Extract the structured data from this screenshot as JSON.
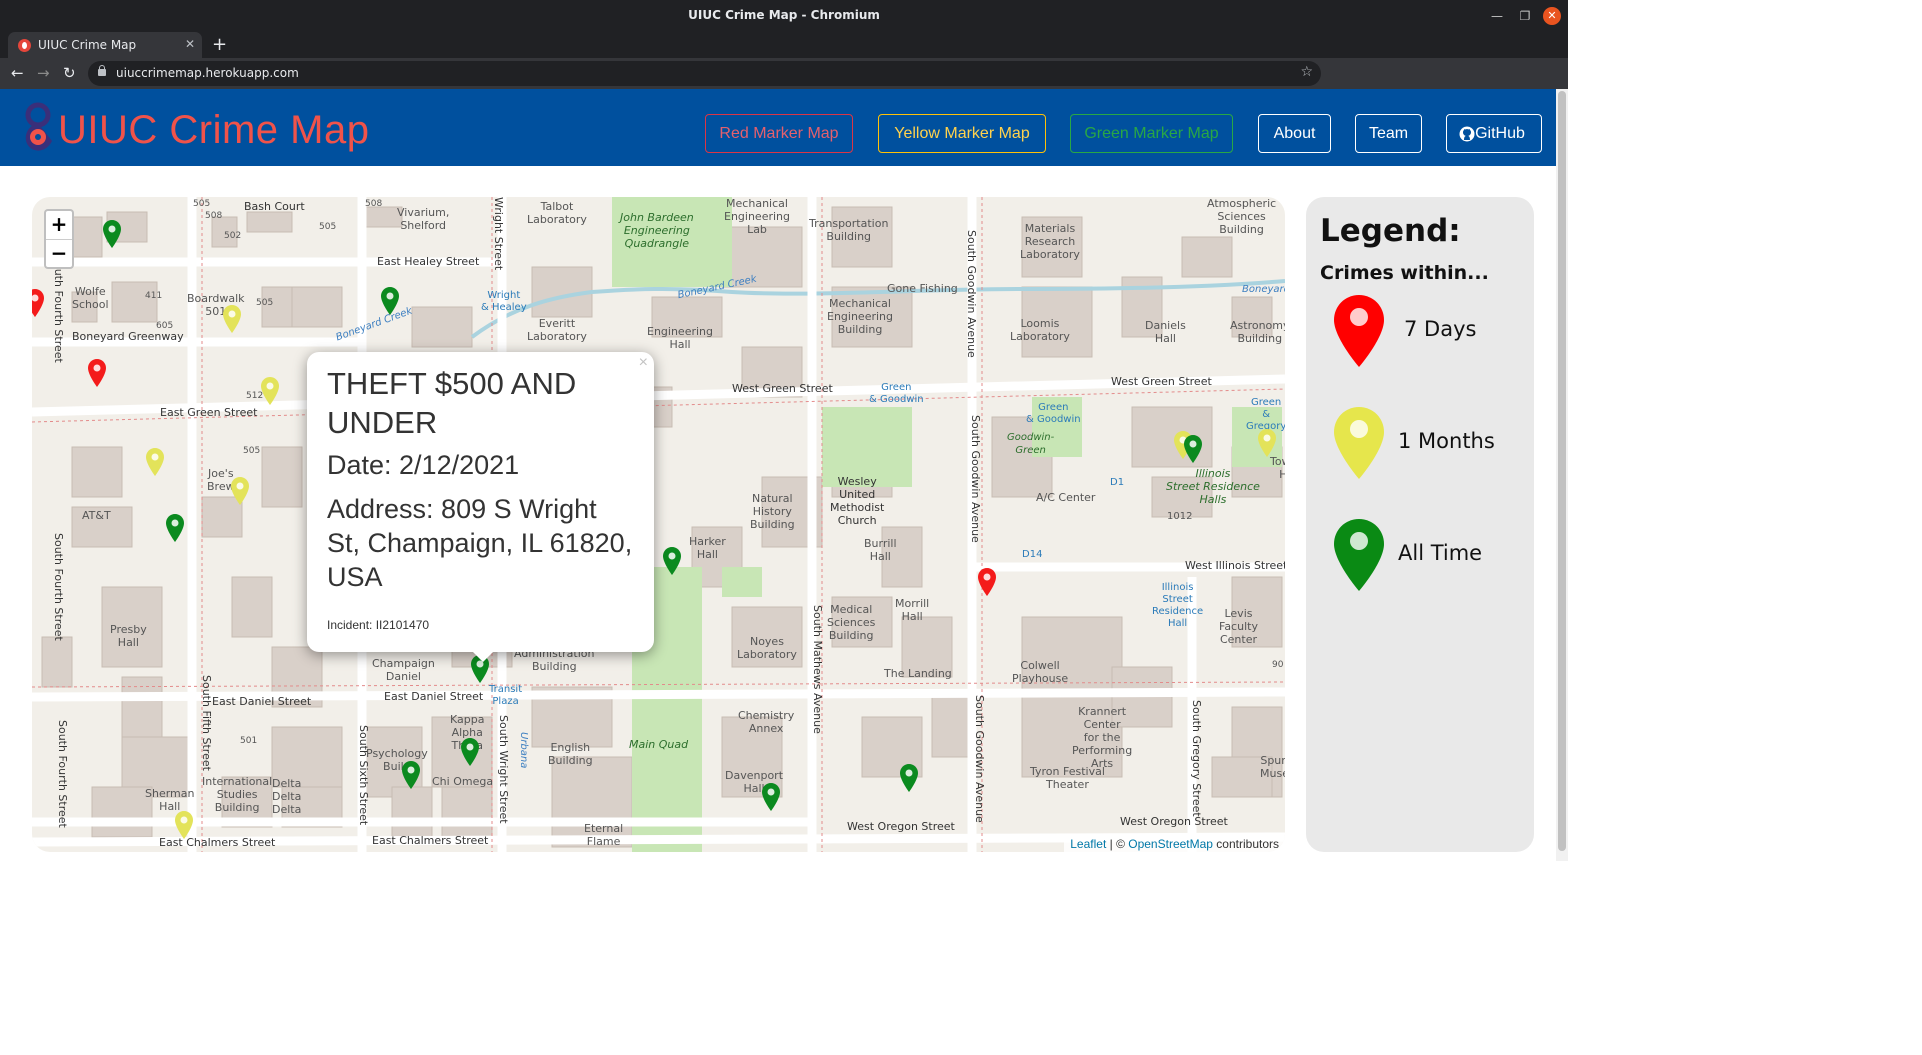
{
  "window": {
    "title": "UIUC Crime Map - Chromium"
  },
  "browser": {
    "tab_title": "UIUC Crime Map",
    "url": "uiuccrimemap.herokuapp.com"
  },
  "navbar": {
    "brand": "UIUC Crime Map",
    "buttons": {
      "red": "Red Marker Map",
      "yellow": "Yellow Marker Map",
      "green": "Green Marker Map",
      "about": "About",
      "team": "Team",
      "github": "GitHub"
    }
  },
  "map": {
    "zoom_in": "+",
    "zoom_out": "−",
    "attribution": {
      "leaflet": "Leaflet",
      "sep": " | © ",
      "osm": "OpenStreetMap",
      "suffix": " contributors"
    },
    "streets": {
      "bash_court": "Bash Court",
      "east_healey": "East Healey Street",
      "boneyard_greenway": "Boneyard Greenway",
      "east_green": "East Green Street",
      "west_green_1": "West Green Street",
      "west_green_2": "West Green Street",
      "west_illinois": "West Illinois Street",
      "east_daniel_1": "East Daniel Street",
      "east_daniel_2": "East Daniel Street",
      "west_oregon_1": "West Oregon Street",
      "west_oregon_2": "West Oregon Street",
      "east_chalmers_1": "East Chalmers Street",
      "east_chalmers_2": "East Chalmers Street",
      "s_goodwin_1": "South Goodwin Avenue",
      "s_goodwin_2": "South Goodwin Avenue",
      "s_goodwin_3": "South Goodwin Avenue",
      "s_mathews": "South Mathews Avenue",
      "s_wright": "South Wright Street",
      "s_sixth": "South Sixth Street",
      "s_fifth": "South Fifth Street",
      "s_fourth_1": "South Fourth Street",
      "s_fourth_2": "South Fourth Street",
      "s_fourth_3": "South Fourth Street",
      "s_gregory": "South Gregory Street",
      "wright_top": "Wright Street"
    },
    "labels": {
      "vivarium": "Vivarium,\nShelford",
      "talbot": "Talbot\nLaboratory",
      "bardeen": "John Bardeen\nEngineering\nQuadrangle",
      "mech_lab": "Mechanical\nEngineering\nLab",
      "transport": "Transportation\nBuilding",
      "materials": "Materials\nResearch\nLaboratory",
      "atmos": "Atmospheric\nSciences\nBuilding",
      "wolfe": "Wolfe\nSchool",
      "boardwalk": "Boardwalk\n501",
      "everitt": "Everitt\nLaboratory",
      "eng_hall": "Engineering\nHall",
      "gone_fishing": "Gone Fishing",
      "mech_bldg": "Mechanical\nEngineering\nBuilding",
      "loomis": "Loomis\nLaboratory",
      "daniels": "Daniels\nHall",
      "astronomy": "Astronomy\nBuilding",
      "wright_healey": "Wright\n& Healey",
      "boneyard_creek_1": "Boneyard Creek",
      "boneyard_creek_2": "Boneyard Creek",
      "boneyard_3": "Boneyard",
      "green_goodwin_1": "Green\n& Goodwin",
      "green_goodwin_2": "Green\n& Goodwin",
      "green_goodwin_3": "Green\n& Gregory",
      "goodwin_green": "Goodwin-\nGreen",
      "isr": "Illinois\nStreet Residence\nHalls",
      "towns": "Towns\nHa",
      "ac_center": "A/C Center",
      "d1": "D1",
      "d14": "D14",
      "n1012": "1012",
      "joes": "Joe's\nBrew",
      "att": "AT&T",
      "wesley": "Wesley\nUnited\nMethodist\nChurch",
      "burrill": "Burrill\nHall",
      "natural_history": "Natural\nHistory\nBuilding",
      "harker": "Harker\nHall",
      "morrill": "Morrill\nHall",
      "isr_stop": "Illinois\nStreet\nResidence\nHall",
      "levis": "Levis\nFaculty\nCenter",
      "presby": "Presby\nHall",
      "noyes": "Noyes\nLaboratory",
      "medical": "Medical\nSciences\nBuilding",
      "colwell": "Colwell\nPlayhouse",
      "krannert": "Krannert\nCenter\nfor the\nPerforming\nArts",
      "tyron": "Tyron Festival\nTheater",
      "landing": "The Landing",
      "champaign_daniel": "Champaign\nDaniel",
      "admin": "Administration\nBuilding",
      "transit_plaza": "Transit\nPlaza",
      "kappa": "Kappa\nAlpha\nTheta",
      "psych": "Psychology\nBuild",
      "chi_omega": "Chi Omega",
      "english": "English\nBuilding",
      "main_quad": "Main Quad",
      "chem_annex": "Chemistry\nAnnex",
      "davenport": "Davenport\nHall",
      "eternal_flame": "Eternal\nFlame",
      "intl": "International\nStudies\nBuilding",
      "delta": "Delta\nDelta\nDelta",
      "sherman": "Sherman\nHall",
      "spurlock": "Spurlo\nMuseu",
      "urbana": "Urbana",
      "n505a": "505",
      "n508a": "508",
      "n502": "502",
      "n505b": "505",
      "n411": "411",
      "n605": "605",
      "n512": "512",
      "n505c": "505",
      "n501": "501",
      "n90": "90",
      "n508b": "508",
      "n505d": "505"
    }
  },
  "popup": {
    "close": "×",
    "title": "THEFT $500 AND UNDER",
    "date": "Date: 2/12/2021",
    "address": "Address: 809 S Wright St, Champaign, IL 61820, USA",
    "incident": "Incident: II2101470"
  },
  "legend": {
    "title": "Legend:",
    "subtitle": "Crimes within...",
    "items": [
      {
        "label": "7 Days",
        "color": "#ff0000"
      },
      {
        "label": "1 Months",
        "color": "#e6e64c"
      },
      {
        "label": "All Time",
        "color": "#0a8a14"
      }
    ]
  },
  "colors": {
    "navbar": "#00509e",
    "brand": "#f0534a",
    "marker_red": "#f41b1b",
    "marker_yellow": "#e3e35a",
    "marker_green": "#0b8a1f"
  },
  "icons": [
    "github-icon",
    "brand-logo-icon",
    "map-marker-icon",
    "zoom-in-icon",
    "zoom-out-icon"
  ]
}
